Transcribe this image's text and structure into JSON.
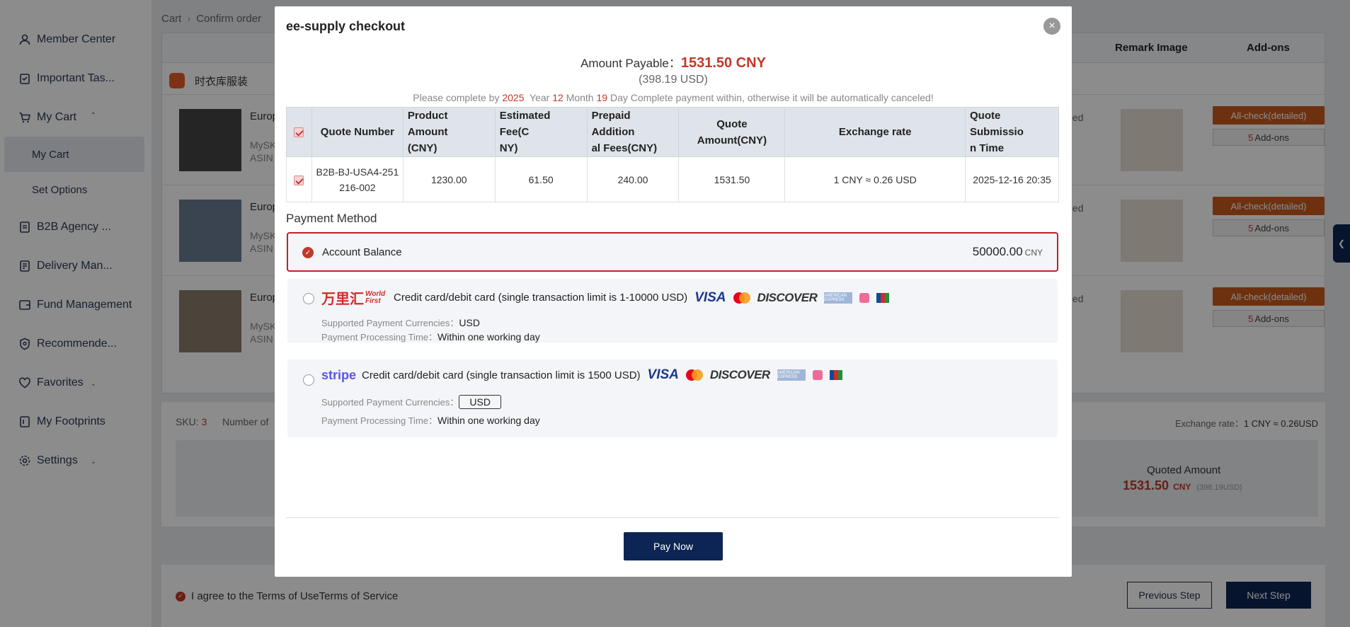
{
  "sidebar": {
    "items": [
      {
        "label": "Member Center",
        "icon": "user-icon"
      },
      {
        "label": "Important Tas...",
        "icon": "clipboard-icon"
      },
      {
        "label": "My Cart",
        "icon": "cart-icon"
      },
      {
        "label": "My Cart",
        "sub": true
      },
      {
        "label": "Set Options",
        "sub": true
      },
      {
        "label": "B2B Agency ...",
        "icon": "document-icon"
      },
      {
        "label": "Delivery Man...",
        "icon": "delivery-icon"
      },
      {
        "label": "Fund Management",
        "icon": "wallet-icon"
      },
      {
        "label": "Recommende...",
        "icon": "shield-icon"
      },
      {
        "label": "Favorites",
        "icon": "heart-icon"
      },
      {
        "label": "My Footprints",
        "icon": "footprint-icon"
      },
      {
        "label": "Settings",
        "icon": "gear-icon"
      }
    ]
  },
  "breadcrumb": {
    "cart": "Cart",
    "confirm": "Confirm order"
  },
  "table_headers": {
    "remark_image": "Remark Image",
    "addons": "Add-ons"
  },
  "store": {
    "name": "时衣库服装"
  },
  "products": [
    {
      "title": "Europ",
      "sub1": "MySK",
      "sub2": "ASIN",
      "side": "ned",
      "btn_all": "All-check(detailed)",
      "addon_count": "5",
      "addon_label": "Add-ons"
    },
    {
      "title": "Europ",
      "sub1": "MySK",
      "sub2": "ASIN",
      "side": "ned",
      "btn_all": "All-check(detailed)",
      "addon_count": "5",
      "addon_label": "Add-ons"
    },
    {
      "title": "Europ",
      "sub1": "MySK",
      "sub2": "ASIN",
      "side": "ned",
      "btn_all": "All-check(detailed)",
      "addon_count": "5",
      "addon_label": "Add-ons"
    }
  ],
  "summary": {
    "sku_label": "SKU:",
    "sku_value": "3",
    "number_of": "Number of",
    "exchange_label": "Exchange rate：",
    "exchange_value": "1 CNY ≈ 0.26USD",
    "quoted_label": "Quoted Amount",
    "quoted_value": "1531.50",
    "quoted_currency": "CNY",
    "quoted_usd": "(398.19USD)"
  },
  "footer": {
    "agree_text": "I agree to the Terms of UseTerms of Service",
    "prev": "Previous Step",
    "next": "Next Step"
  },
  "modal": {
    "title": "ee-supply checkout",
    "amount_label": "Amount Payable：",
    "amount_value": "1531.50 CNY",
    "amount_usd": "(398.19 USD)",
    "deadline": {
      "prefix": "Please complete by",
      "year": "2025",
      "year_label": "Year",
      "month": "12",
      "month_label": "Month",
      "day": "19",
      "suffix": "Day Complete payment within, otherwise it will be automatically canceled!"
    },
    "quote_table": {
      "headers": [
        "Quote Number",
        "Product Amount (CNY)",
        "Estimated Fee(CNY)",
        "Prepaid Additional Fees(CNY)",
        "Quote Amount(CNY)",
        "Exchange rate",
        "Quote Submission Time"
      ],
      "header_lines": [
        [
          "Quote Number"
        ],
        [
          "Product Amount",
          "(CNY)"
        ],
        [
          "Estimated Fee(C",
          "NY)"
        ],
        [
          "Prepaid Addition",
          "al Fees(CNY)"
        ],
        [
          "Quote Amount(CNY)"
        ],
        [
          "Exchange rate"
        ],
        [
          "Quote Submissio",
          "n Time"
        ]
      ],
      "row": {
        "quote_number_1": "B2B-BJ-USA4-251",
        "quote_number_2": "216-002",
        "product_amount": "1230.00",
        "estimated_fee": "61.50",
        "prepaid_fees": "240.00",
        "quote_amount": "1531.50",
        "exchange_rate": "1 CNY ≈ 0.26 USD",
        "submission_time": "2025-12-16 20:35"
      }
    },
    "payment_method_label": "Payment Method",
    "balance": {
      "label": "Account Balance",
      "value": "50000.00",
      "currency": "CNY"
    },
    "worldfirst": {
      "brand_cn": "万里汇",
      "brand_en": "World First",
      "description": "Credit card/debit card (single transaction limit is 1-10000 USD)",
      "currencies_label": "Supported Payment Currencies：",
      "currencies_value": "USD",
      "time_label": "Payment Processing Time：",
      "time_value": "Within one working day"
    },
    "stripe": {
      "brand": "stripe",
      "description": "Credit card/debit card (single transaction limit is 1500 USD)",
      "currencies_label": "Supported Payment Currencies：",
      "currencies_value": "USD",
      "time_label": "Payment Processing Time：",
      "time_value": "Within one working day"
    },
    "card_logos": {
      "visa": "VISA",
      "discover": "DISCOVER",
      "amex": "AMERICAN EXPRESS"
    },
    "pay_button": "Pay Now"
  },
  "colors": {
    "accent_red": "#c0392b",
    "navy": "#0d2554",
    "orange": "#c65a1e"
  }
}
